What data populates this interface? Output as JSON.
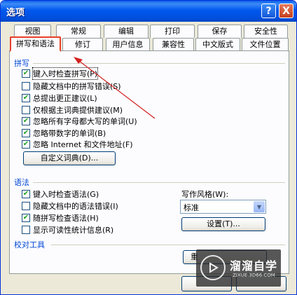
{
  "window": {
    "title": "选项"
  },
  "titlebar_buttons": {
    "help": "?",
    "close": "X"
  },
  "tabs_row_back": [
    "视图",
    "常规",
    "编辑",
    "打印",
    "保存",
    "安全性"
  ],
  "tabs_row_front": [
    "拼写和语法",
    "修订",
    "用户信息",
    "兼容性",
    "中文版式",
    "文件位置"
  ],
  "active_tab": "拼写和语法",
  "spelling": {
    "section": "拼写",
    "options": [
      {
        "label": "键入时检查拼写(P)",
        "checked": true
      },
      {
        "label": "隐藏文档中的拼写错误(S)",
        "checked": false
      },
      {
        "label": "总提出更正建议(L)",
        "checked": true
      },
      {
        "label": "仅根据主词典提供建议(M)",
        "checked": false
      },
      {
        "label": "忽略所有字母都大写的单词(U)",
        "checked": true
      },
      {
        "label": "忽略带数字的单词(B)",
        "checked": true
      },
      {
        "label": "忽略 Internet 和文件地址(F)",
        "checked": true
      }
    ],
    "custom_dict_button": "自定义词典(D)..."
  },
  "grammar": {
    "section": "语法",
    "options": [
      {
        "label": "键入时检查语法(G)",
        "checked": true
      },
      {
        "label": "隐藏文档中的语法错误(I)",
        "checked": false
      },
      {
        "label": "随拼写检查语法(H)",
        "checked": true
      },
      {
        "label": "显示可读性统计信息(R)",
        "checked": false
      }
    ],
    "style_label": "写作风格(W):",
    "style_value": "标准",
    "settings_button": "设置(T)..."
  },
  "proofing": {
    "section": "校对工具",
    "recheck_button_partial": "重"
  },
  "colors": {
    "titlebar": "#0058ee",
    "accent_label": "#0046d5",
    "highlight": "#e8402a",
    "check": "#21a121"
  },
  "watermark": {
    "brand": "溜溜自学",
    "site": "ZIXUE.3D66.COM"
  }
}
